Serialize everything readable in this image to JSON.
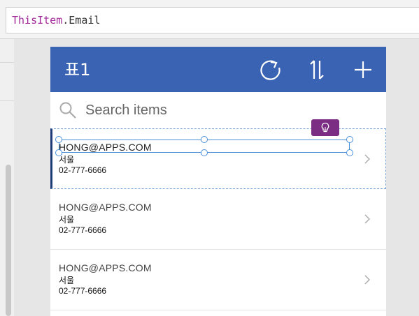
{
  "formula": {
    "object": "ThisItem",
    "dot": ".",
    "property": "Email"
  },
  "app": {
    "title": "표1",
    "header_color": "#3b63b4",
    "icons": [
      "refresh-icon",
      "sort-icon",
      "add-icon"
    ]
  },
  "search": {
    "placeholder": "Search items",
    "value": ""
  },
  "items": [
    {
      "email": "HONG@APPS.COM",
      "city": "서울",
      "phone": "02-777-6666"
    },
    {
      "email": "HONG@APPS.COM",
      "city": "서울",
      "phone": "02-777-6666"
    },
    {
      "email": "HONG@APPS.COM",
      "city": "서울",
      "phone": "02-777-6666"
    }
  ],
  "selection": {
    "accent": "#4a90d9",
    "idea_button_color": "#7a2d83",
    "idea_icon": "lightbulb-icon"
  }
}
